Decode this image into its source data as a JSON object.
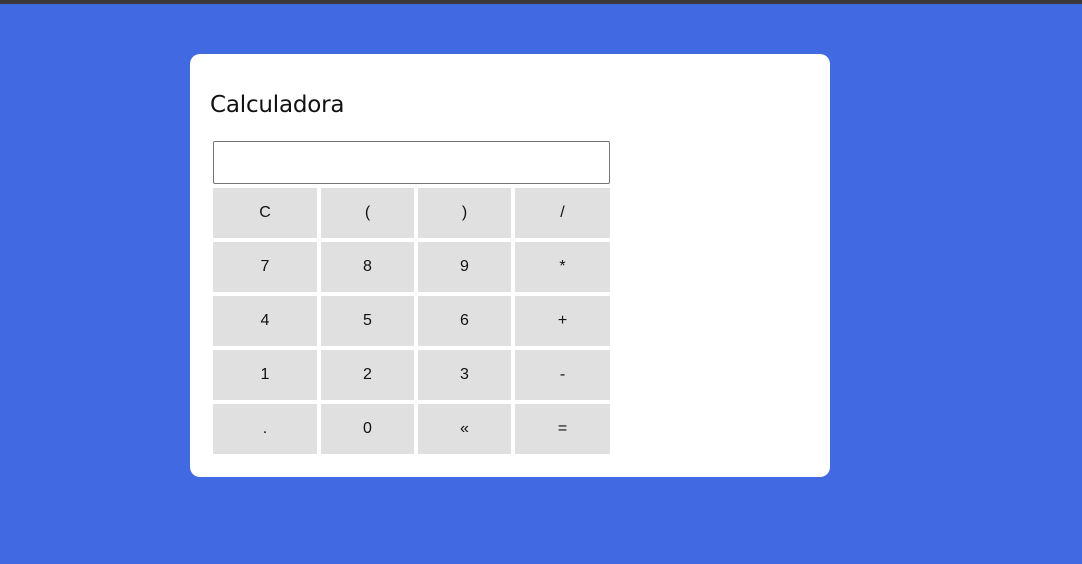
{
  "app": {
    "title": "Calculadora"
  },
  "display": {
    "value": ""
  },
  "keys": {
    "clear": "C",
    "open_paren": "(",
    "close_paren": ")",
    "divide": "/",
    "seven": "7",
    "eight": "8",
    "nine": "9",
    "multiply": "*",
    "four": "4",
    "five": "5",
    "six": "6",
    "plus": "+",
    "one": "1",
    "two": "2",
    "three": "3",
    "minus": "-",
    "decimal": ".",
    "zero": "0",
    "backspace": "«",
    "equals": "="
  },
  "colors": {
    "background": "#4169e1",
    "card": "#ffffff",
    "key": "#e0e0e0"
  }
}
